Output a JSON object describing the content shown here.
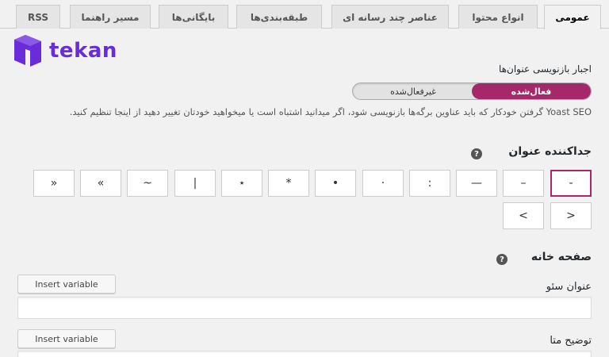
{
  "tabs": [
    {
      "label": "عمومی",
      "active": true
    },
    {
      "label": "انواع محتوا",
      "active": false
    },
    {
      "label": "عناصر چند رسانه ای",
      "active": false
    },
    {
      "label": "طبقه‌بندی‌ها",
      "active": false
    },
    {
      "label": "بایگانی‌ها",
      "active": false
    },
    {
      "label": "مسیر راهنما",
      "active": false
    },
    {
      "label": "RSS",
      "active": false
    }
  ],
  "logo": {
    "text": "tekan",
    "color": "#6a2bd9"
  },
  "force_rewrite": {
    "label": "اجبار بازنویسی عنوان‌ها",
    "on_label": "فعال‌شده",
    "off_label": "غیرفعال‌شده",
    "accent": "#a4286a",
    "description": "Yoast SEO گرفتن خودکار که باید عناوین برگه‌ها بازنویسی شود، اگر میدانید اشتباه است یا میخواهید خودتان تغییر دهید از اینجا تنظیم کنید."
  },
  "separator": {
    "heading": "جداکننده عنوان",
    "help_icon": "question-icon",
    "options": [
      "-",
      "–",
      "—",
      ":",
      "·",
      "•",
      "*",
      "⋆",
      "|",
      "~",
      "«",
      "»",
      ">",
      "<"
    ],
    "selected": "-"
  },
  "homepage": {
    "heading": "صفحه خانه",
    "help_icon": "question-icon",
    "seo_title_label": "عنوان سئو",
    "seo_title_value": "",
    "meta_desc_label": "توضیح متا",
    "meta_desc_value": "",
    "insert_variable": "Insert variable"
  }
}
